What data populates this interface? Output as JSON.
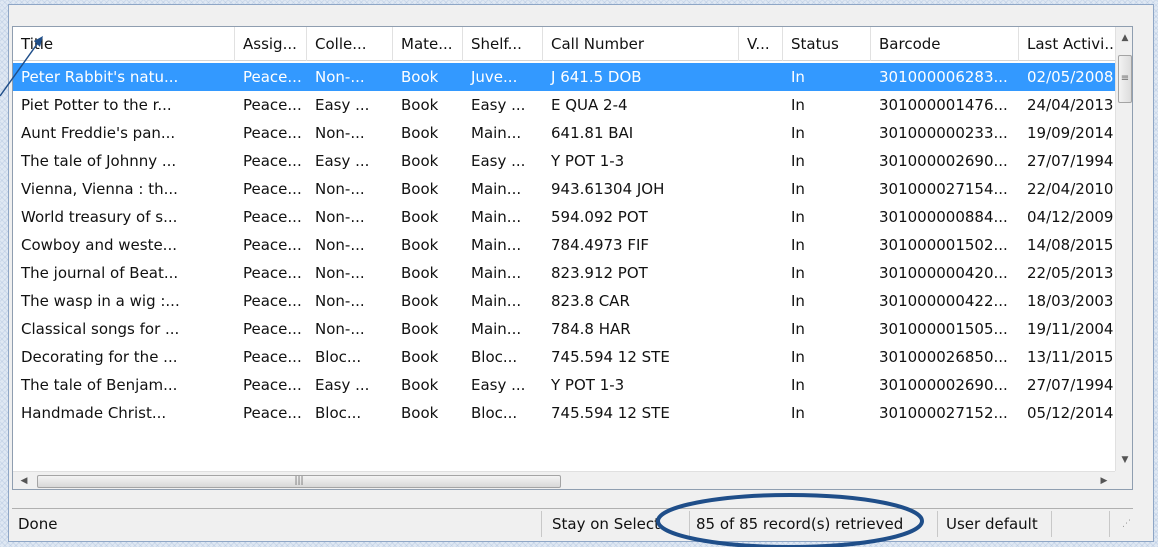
{
  "columns": [
    "Title",
    "Assig...",
    "Colle...",
    "Mate...",
    "Shelf...",
    "Call Number",
    "V...",
    "Status",
    "Barcode",
    "Last Activi..."
  ],
  "rows": [
    [
      "Peter Rabbit's natu...",
      "Peace...",
      "Non-...",
      "Book",
      "Juve...",
      "J 641.5 DOB",
      "",
      "In",
      "301000006283...",
      "02/05/2008"
    ],
    [
      "Piet Potter to the r...",
      "Peace...",
      "Easy ...",
      "Book",
      "Easy ...",
      "E QUA 2-4",
      "",
      "In",
      "301000001476...",
      "24/04/2013"
    ],
    [
      "Aunt Freddie's pan...",
      "Peace...",
      "Non-...",
      "Book",
      "Main...",
      "641.81 BAI",
      "",
      "In",
      "301000000233...",
      "19/09/2014"
    ],
    [
      "The tale of Johnny ...",
      "Peace...",
      "Easy ...",
      "Book",
      "Easy ...",
      "Y POT 1-3",
      "",
      "In",
      "301000002690...",
      "27/07/1994"
    ],
    [
      "Vienna, Vienna : th...",
      "Peace...",
      "Non-...",
      "Book",
      "Main...",
      "943.61304 JOH",
      "",
      "In",
      "301000027154...",
      "22/04/2010"
    ],
    [
      "World treasury of s...",
      "Peace...",
      "Non-...",
      "Book",
      "Main...",
      "594.092 POT",
      "",
      "In",
      "301000000884...",
      "04/12/2009"
    ],
    [
      "Cowboy and weste...",
      "Peace...",
      "Non-...",
      "Book",
      "Main...",
      "784.4973 FIF",
      "",
      "In",
      "301000001502...",
      "14/08/2015"
    ],
    [
      "The journal of Beat...",
      "Peace...",
      "Non-...",
      "Book",
      "Main...",
      "823.912 POT",
      "",
      "In",
      "301000000420...",
      "22/05/2013"
    ],
    [
      "The wasp in a wig :...",
      "Peace...",
      "Non-...",
      "Book",
      "Main...",
      "823.8 CAR",
      "",
      "In",
      "301000000422...",
      "18/03/2003"
    ],
    [
      "Classical songs for ...",
      "Peace...",
      "Non-...",
      "Book",
      "Main...",
      "784.8 HAR",
      "",
      "In",
      "301000001505...",
      "19/11/2004"
    ],
    [
      "Decorating for the ...",
      "Peace...",
      "Bloc...",
      "Book",
      "Bloc...",
      "745.594 12 STE",
      "",
      "In",
      "301000026850...",
      "13/11/2015"
    ],
    [
      "The tale of Benjam...",
      "Peace...",
      "Easy ...",
      "Book",
      "Easy ...",
      "Y POT 1-3",
      "",
      "In",
      "301000002690...",
      "27/07/1994"
    ],
    [
      "Handmade Christ...",
      "Peace...",
      "Bloc...",
      "Book",
      "Bloc...",
      "745.594 12 STE",
      "",
      "In",
      "301000027152...",
      "05/12/2014"
    ]
  ],
  "selected_row": 0,
  "status": {
    "left": "Done",
    "mode": "Stay on Select",
    "count": "85 of 85 record(s) retrieved",
    "profile": "User default"
  },
  "icons": {
    "scroll_up": "up-arrow-icon",
    "scroll_down": "down-arrow-icon",
    "scroll_left": "left-arrow-icon",
    "scroll_right": "right-arrow-icon",
    "size_grip": "size-grip-icon"
  },
  "colors": {
    "selection": "#3399ff",
    "annotation": "#1f4e89"
  }
}
